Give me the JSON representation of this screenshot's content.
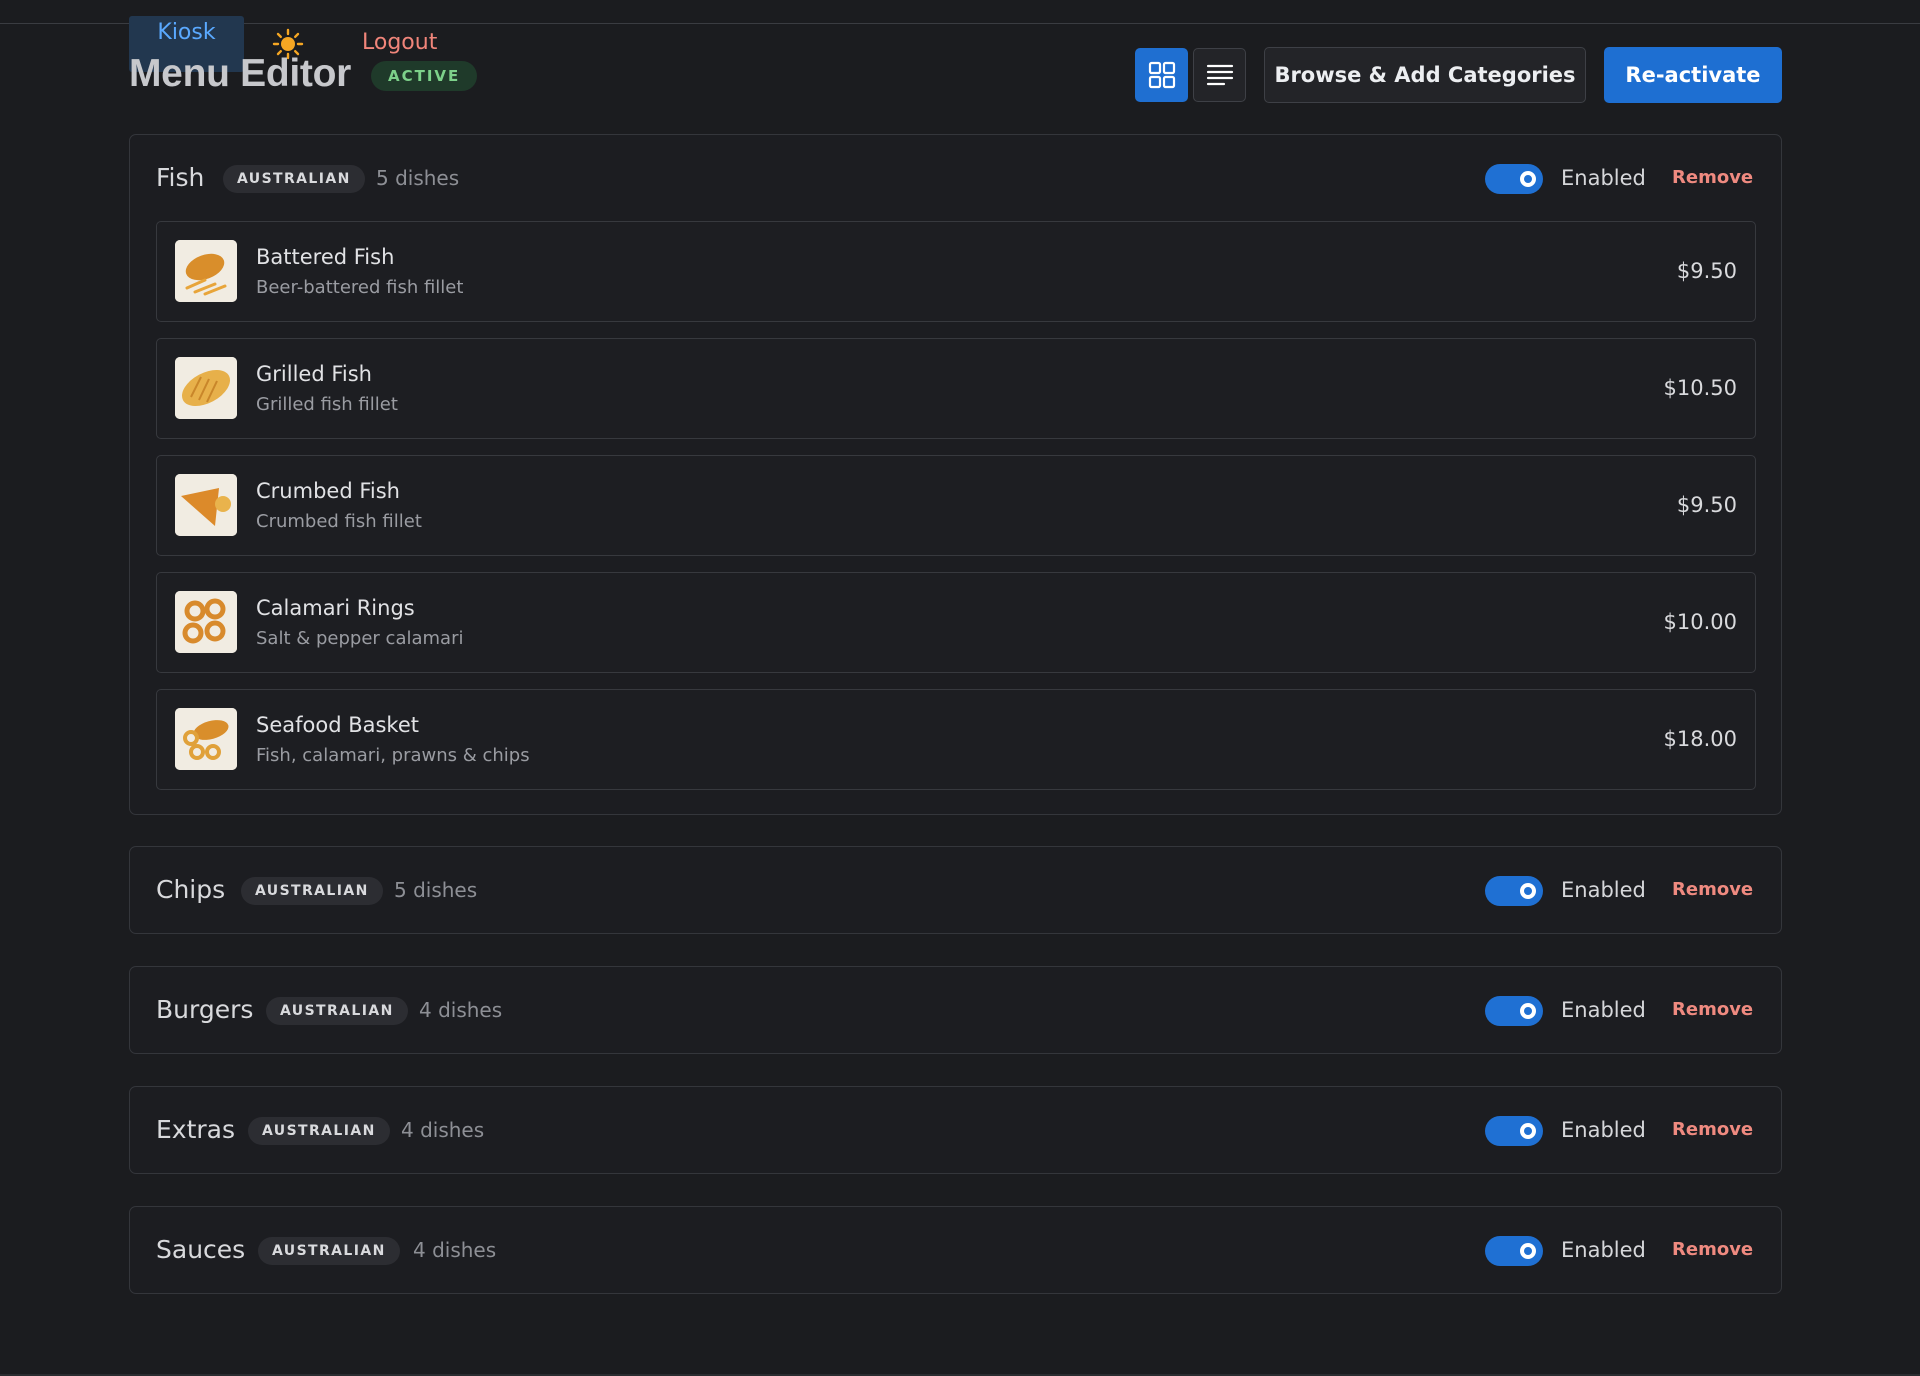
{
  "nav": {
    "kiosk": "Kiosk",
    "logout": "Logout"
  },
  "header": {
    "title": "Menu Editor",
    "status": "ACTIVE",
    "browse_label": "Browse & Add Categories",
    "reactivate_label": "Re-activate",
    "view_grid_icon": "grid-icon",
    "view_list_icon": "list-icon"
  },
  "colors": {
    "accent": "#1e6fd2",
    "remove": "#ef8a80",
    "active": "#7dd18a",
    "background": "#1b1c1f"
  },
  "categories": [
    {
      "name": "Fish",
      "cuisine": "AUSTRALIAN",
      "count": "5 dishes",
      "toggle": "Enabled",
      "remove": "Remove",
      "dishes": [
        {
          "name": "Battered Fish",
          "desc": "Beer-battered fish fillet",
          "price": "$9.50"
        },
        {
          "name": "Grilled Fish",
          "desc": "Grilled fish fillet",
          "price": "$10.50"
        },
        {
          "name": "Crumbed Fish",
          "desc": "Crumbed fish fillet",
          "price": "$9.50"
        },
        {
          "name": "Calamari Rings",
          "desc": "Salt & pepper calamari",
          "price": "$10.00"
        },
        {
          "name": "Seafood Basket",
          "desc": "Fish, calamari, prawns & chips",
          "price": "$18.00"
        }
      ]
    },
    {
      "name": "Chips",
      "cuisine": "AUSTRALIAN",
      "count": "5 dishes",
      "toggle": "Enabled",
      "remove": "Remove"
    },
    {
      "name": "Burgers",
      "cuisine": "AUSTRALIAN",
      "count": "4 dishes",
      "toggle": "Enabled",
      "remove": "Remove"
    },
    {
      "name": "Extras",
      "cuisine": "AUSTRALIAN",
      "count": "4 dishes",
      "toggle": "Enabled",
      "remove": "Remove"
    },
    {
      "name": "Sauces",
      "cuisine": "AUSTRALIAN",
      "count": "4 dishes",
      "toggle": "Enabled",
      "remove": "Remove"
    }
  ]
}
